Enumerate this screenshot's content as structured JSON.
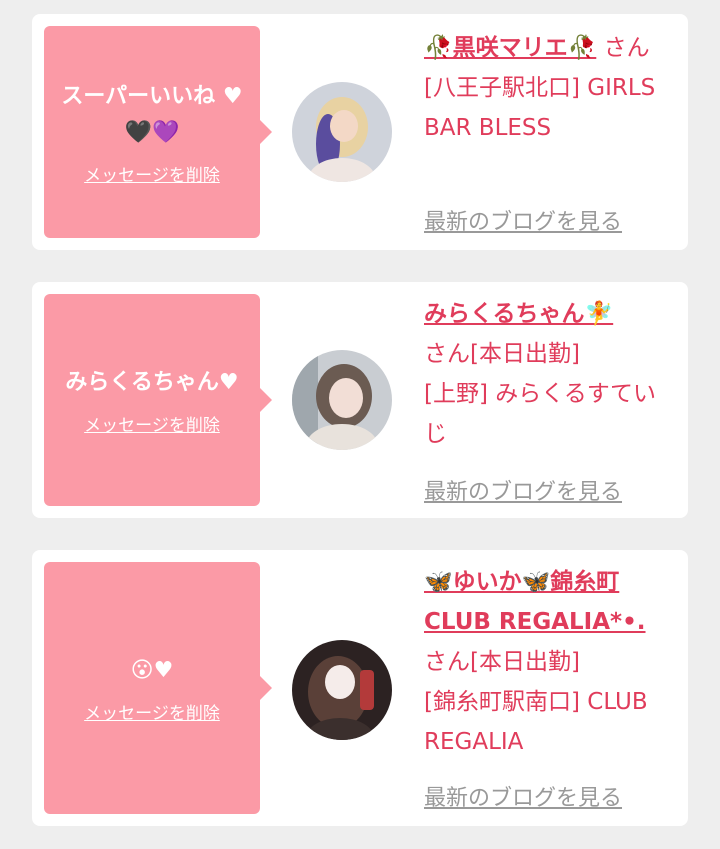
{
  "messages": [
    {
      "text": "スーパーいいね ♥ 🖤💜",
      "delete_label": "メッセージを削除",
      "name": "🥀黒咲マリエ🥀",
      "suffix": "さん",
      "shop": "[八王子駅北口] GIRLS BAR BLESS",
      "blog_label": "最新のブログを見る"
    },
    {
      "text": "みらくるちゃん♥",
      "delete_label": "メッセージを削除",
      "name": "みらくるちゃん🧚",
      "suffix": "さん[本日出勤]",
      "shop": "[上野] みらくるすていじ",
      "blog_label": "最新のブログを見る"
    },
    {
      "text": "😮♥",
      "delete_label": "メッセージを削除",
      "name": "🦋ゆいか🦋錦糸町CLUB REGALIA*•.",
      "suffix": "さん[本日出勤]",
      "shop": "[錦糸町駅南口] CLUB REGALIA",
      "blog_label": "最新のブログを見る"
    }
  ],
  "colors": {
    "bubble": "#fb9aa6",
    "name_text": "#e03c5b",
    "link_gray": "#999999"
  }
}
